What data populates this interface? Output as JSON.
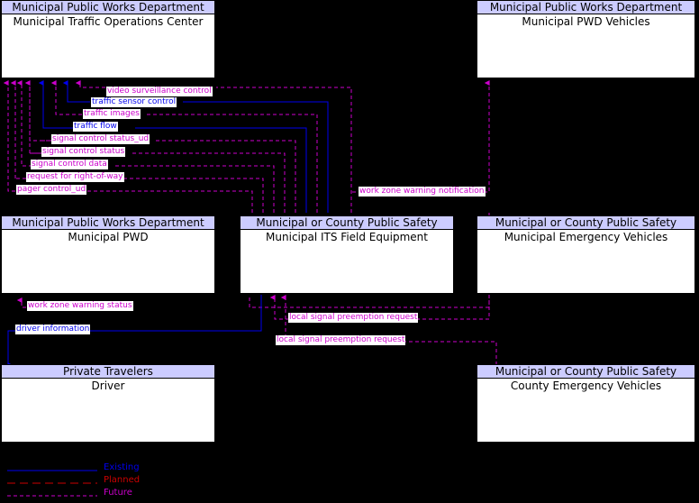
{
  "diagram": {
    "type": "context-diagram",
    "background": "#000000",
    "boxes": [
      {
        "id": "municipal-traffic-operations-center",
        "stakeholder": "Municipal Public Works Department",
        "name": "Municipal Traffic Operations Center",
        "emphasis": false
      },
      {
        "id": "municipal-pwd-vehicles",
        "stakeholder": "Municipal Public Works Department",
        "name": "Municipal PWD Vehicles",
        "emphasis": false
      },
      {
        "id": "municipal-pwd",
        "stakeholder": "Municipal Public Works Department",
        "name": "Municipal PWD",
        "emphasis": false
      },
      {
        "id": "municipal-its-field-equipment",
        "stakeholder": "Municipal or County Public Safety",
        "name": "Municipal ITS Field Equipment",
        "emphasis": true
      },
      {
        "id": "municipal-emergency-vehicles",
        "stakeholder": "Municipal or County Public Safety",
        "name": "Municipal Emergency Vehicles",
        "emphasis": false
      },
      {
        "id": "driver",
        "stakeholder": "Private Travelers",
        "name": "Driver",
        "emphasis": false
      },
      {
        "id": "county-emergency-vehicles",
        "stakeholder": "Municipal or County Public Safety",
        "name": "County Emergency Vehicles",
        "emphasis": false
      }
    ],
    "flows": [
      {
        "id": "video-surveillance-control",
        "label": "video surveillance control",
        "status": "future"
      },
      {
        "id": "traffic-sensor-control",
        "label": "traffic sensor control",
        "status": "existing"
      },
      {
        "id": "traffic-images",
        "label": "traffic images",
        "status": "future"
      },
      {
        "id": "traffic-flow",
        "label": "traffic flow",
        "status": "existing"
      },
      {
        "id": "signal-control-status-ud",
        "label": "signal control status_ud",
        "status": "future"
      },
      {
        "id": "signal-control-status",
        "label": "signal control status",
        "status": "future"
      },
      {
        "id": "signal-control-data",
        "label": "signal control data",
        "status": "future"
      },
      {
        "id": "request-for-right-of-way",
        "label": "request for right-of-way",
        "status": "future"
      },
      {
        "id": "pager-control-ud",
        "label": "pager control_ud",
        "status": "future"
      },
      {
        "id": "work-zone-warning-notification",
        "label": "work zone warning notification",
        "status": "future"
      },
      {
        "id": "work-zone-warning-status",
        "label": "work zone warning status",
        "status": "future"
      },
      {
        "id": "driver-information",
        "label": "driver information",
        "status": "existing"
      },
      {
        "id": "local-signal-preemption-request-1",
        "label": "local signal preemption request",
        "status": "future"
      },
      {
        "id": "local-signal-preemption-request-2",
        "label": "local signal preemption request",
        "status": "future"
      }
    ]
  },
  "legend": {
    "items": [
      {
        "id": "existing",
        "label": "Existing",
        "color": "#0000ee",
        "style": "solid"
      },
      {
        "id": "planned",
        "label": "Planned",
        "color": "#cc0000",
        "style": "dashed"
      },
      {
        "id": "future",
        "label": "Future",
        "color": "#cc00cc",
        "style": "dashed"
      }
    ]
  }
}
